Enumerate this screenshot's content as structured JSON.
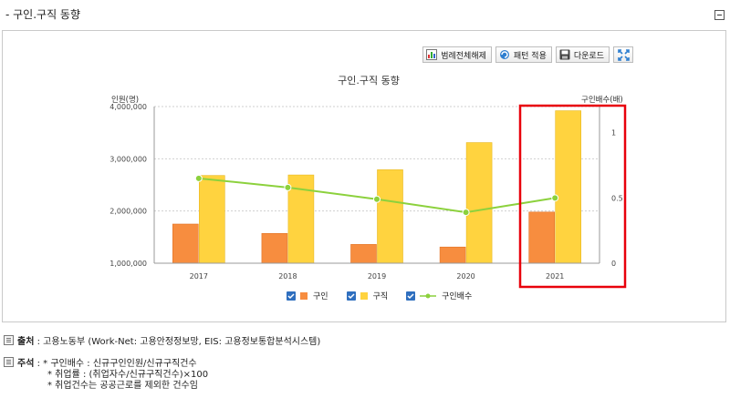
{
  "section_title": "- 구인.구직 동향",
  "toolbar": {
    "legend_toggle": "범례전체해제",
    "pattern": "패턴 적용",
    "download": "다운로드"
  },
  "icons": [
    "legend-icon",
    "pattern-icon",
    "disk-icon",
    "fullscreen-icon",
    "collapse-icon",
    "source-icon",
    "note-icon"
  ],
  "colors": {
    "job_openings": "#F78D3F",
    "job_seekers": "#FFD33F",
    "ratio": "#8CD13D",
    "highlight": "#E8000B",
    "checkbox": "#2F6FBF"
  },
  "legend": [
    {
      "label": "구인",
      "checked": true
    },
    {
      "label": "구직",
      "checked": true
    },
    {
      "label": "구인배수",
      "checked": true
    }
  ],
  "source": {
    "label": "출처",
    "text": ": 고용노동부 (Work-Net: 고용안정정보망, EIS: 고용정보통합분석시스템)"
  },
  "notes": {
    "label": "주석",
    "lines": [
      ": * 구인배수 : 신규구인인원/신규구직건수",
      "* 취업률 : (취업자수/신규구직건수)×100",
      "* 취업건수는 공공근로를 제외한 건수임"
    ]
  },
  "chart_data": {
    "type": "bar",
    "title": "구인.구직 동향",
    "categories": [
      "2017",
      "2018",
      "2019",
      "2020",
      "2021"
    ],
    "y_left": {
      "label": "인원(명)",
      "min": 1000000,
      "max": 4000000,
      "ticks": [
        "1,000,000",
        "2,000,000",
        "3,000,000",
        "4,000,000"
      ],
      "tick_values": [
        1000000,
        2000000,
        3000000,
        4000000
      ]
    },
    "y_right": {
      "label": "구인배수(배)",
      "min": 0,
      "max": 1.2,
      "ticks": [
        "0",
        "0.5",
        "1"
      ],
      "tick_values": [
        0,
        0.5,
        1
      ]
    },
    "series": [
      {
        "name": "구인",
        "type": "bar",
        "axis": "left",
        "values": [
          1750000,
          1570000,
          1360000,
          1310000,
          1980000
        ]
      },
      {
        "name": "구직",
        "type": "bar",
        "axis": "left",
        "values": [
          2680000,
          2690000,
          2790000,
          3310000,
          3920000
        ]
      },
      {
        "name": "구인배수",
        "type": "line",
        "axis": "right",
        "values": [
          0.65,
          0.58,
          0.49,
          0.39,
          0.5
        ]
      }
    ],
    "highlight_category": "2021",
    "grid": true
  }
}
